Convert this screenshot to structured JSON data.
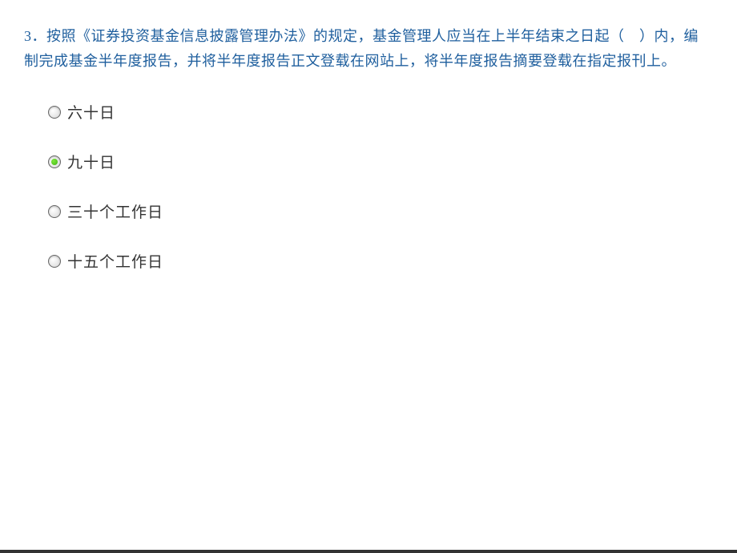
{
  "question": {
    "number": "3．",
    "text": "按照《证券投资基金信息披露管理办法》的规定，基金管理人应当在上半年结束之日起（　）内，编制完成基金半年度报告，并将半年度报告正文登载在网站上，将半年度报告摘要登载在指定报刊上。"
  },
  "options": [
    {
      "label": "六十日",
      "selected": false
    },
    {
      "label": "九十日",
      "selected": true
    },
    {
      "label": "三十个工作日",
      "selected": false
    },
    {
      "label": "十五个工作日",
      "selected": false
    }
  ]
}
